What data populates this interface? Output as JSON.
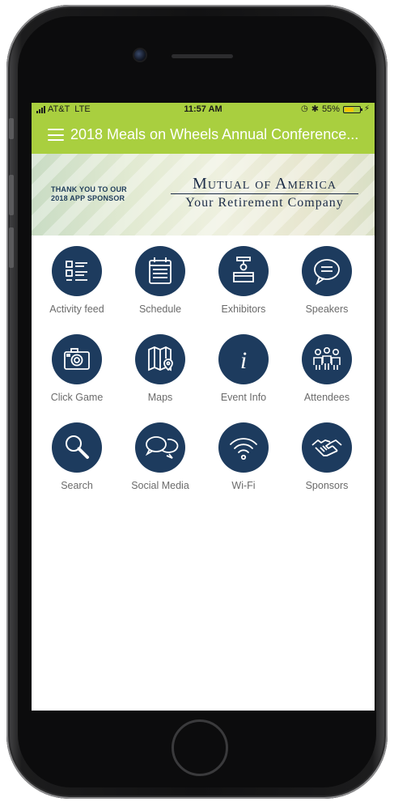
{
  "status": {
    "carrier": "AT&T",
    "network": "LTE",
    "time": "11:57 AM",
    "battery": "55%",
    "battery_level": 0.55,
    "icons": [
      "signal-icon",
      "alarm-icon",
      "bluetooth-icon",
      "battery-icon",
      "charging-icon"
    ]
  },
  "header": {
    "title": "2018 Meals on Wheels Annual Conference...",
    "menu_icon": "hamburger-icon",
    "color": "#a9cf3f"
  },
  "banner": {
    "thanks_line1": "THANK YOU TO OUR",
    "thanks_line2": "2018 APP SPONSOR",
    "logo_line1": "Mutual of America",
    "logo_line2": "Your Retirement Company"
  },
  "tiles": [
    {
      "label": "Activity feed",
      "icon": "activity-feed-icon"
    },
    {
      "label": "Schedule",
      "icon": "calendar-icon"
    },
    {
      "label": "Exhibitors",
      "icon": "exhibitor-booth-icon"
    },
    {
      "label": "Speakers",
      "icon": "speech-bubble-icon"
    },
    {
      "label": "Click Game",
      "icon": "camera-icon"
    },
    {
      "label": "Maps",
      "icon": "map-icon"
    },
    {
      "label": "Event Info",
      "icon": "info-icon"
    },
    {
      "label": "Attendees",
      "icon": "people-icon"
    },
    {
      "label": "Search",
      "icon": "search-icon"
    },
    {
      "label": "Social Media",
      "icon": "chat-bubbles-icon"
    },
    {
      "label": "Wi-Fi",
      "icon": "wifi-icon"
    },
    {
      "label": "Sponsors",
      "icon": "handshake-icon"
    }
  ],
  "colors": {
    "accent": "#a9cf3f",
    "icon_bg": "#1d3b5e",
    "label": "#6b6b6b"
  }
}
